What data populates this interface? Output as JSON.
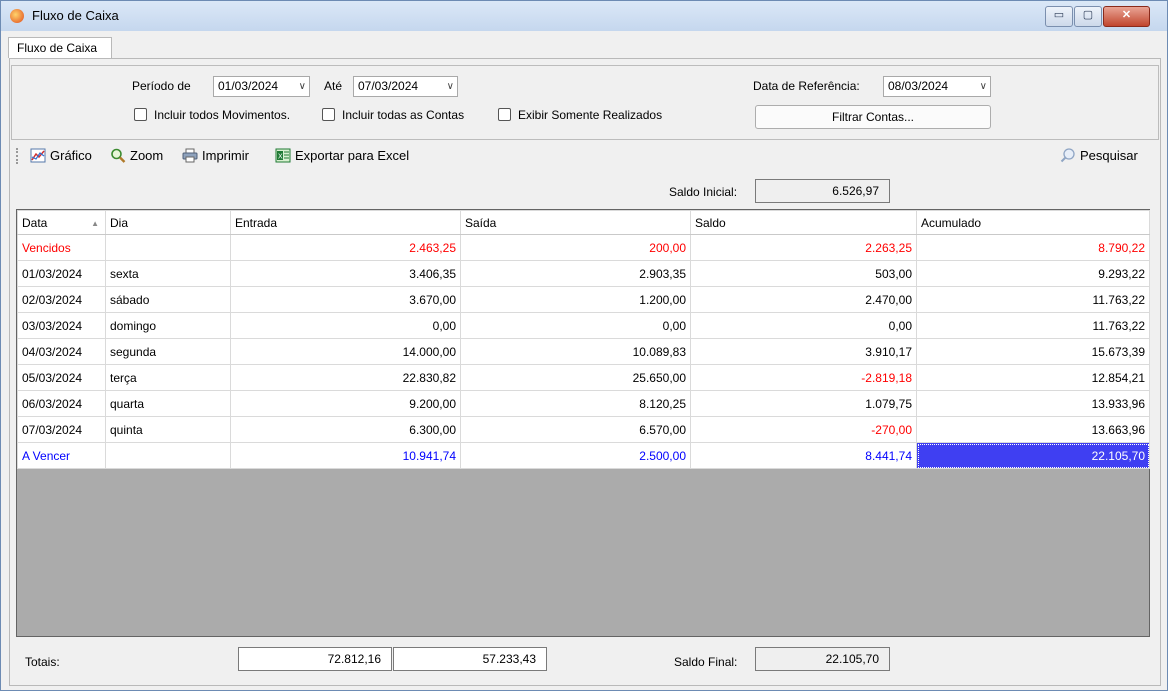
{
  "window": {
    "title": "Fluxo de Caixa",
    "controls": {
      "minimize": "▭",
      "maximize": "▢",
      "close": "✕"
    }
  },
  "tab": {
    "label": "Fluxo de Caixa"
  },
  "filters": {
    "periodo_label": "Período de",
    "periodo_de": "01/03/2024",
    "ate_label": "Até",
    "periodo_ate": "07/03/2024",
    "data_ref_label": "Data de Referência:",
    "data_ref": "08/03/2024",
    "chk_movimentos": "Incluir todos Movimentos.",
    "chk_contas": "Incluir todas as Contas",
    "chk_realizados": "Exibir Somente Realizados",
    "filtrar_button": "Filtrar Contas...",
    "dropdown_glyph": "∨"
  },
  "toolbar": {
    "grafico": "Gráfico",
    "zoom": "Zoom",
    "imprimir": "Imprimir",
    "exportar": "Exportar para Excel",
    "pesquisar": "Pesquisar"
  },
  "saldo_inicial": {
    "label": "Saldo Inicial:",
    "value": "6.526,97"
  },
  "table": {
    "headers": {
      "data": "Data",
      "dia": "Dia",
      "entrada": "Entrada",
      "saida": "Saída",
      "saldo": "Saldo",
      "acumulado": "Acumulado"
    },
    "sort_glyph": "▲",
    "rows": [
      {
        "data": "Vencidos",
        "dia": "",
        "entrada": "2.463,25",
        "saida": "200,00",
        "saldo": "2.263,25",
        "acumulado": "8.790,22"
      },
      {
        "data": "01/03/2024",
        "dia": "sexta",
        "entrada": "3.406,35",
        "saida": "2.903,35",
        "saldo": "503,00",
        "acumulado": "9.293,22"
      },
      {
        "data": "02/03/2024",
        "dia": "sábado",
        "entrada": "3.670,00",
        "saida": "1.200,00",
        "saldo": "2.470,00",
        "acumulado": "11.763,22"
      },
      {
        "data": "03/03/2024",
        "dia": "domingo",
        "entrada": "0,00",
        "saida": "0,00",
        "saldo": "0,00",
        "acumulado": "11.763,22"
      },
      {
        "data": "04/03/2024",
        "dia": "segunda",
        "entrada": "14.000,00",
        "saida": "10.089,83",
        "saldo": "3.910,17",
        "acumulado": "15.673,39"
      },
      {
        "data": "05/03/2024",
        "dia": "terça",
        "entrada": "22.830,82",
        "saida": "25.650,00",
        "saldo": "-2.819,18",
        "acumulado": "12.854,21"
      },
      {
        "data": "06/03/2024",
        "dia": "quarta",
        "entrada": "9.200,00",
        "saida": "8.120,25",
        "saldo": "1.079,75",
        "acumulado": "13.933,96"
      },
      {
        "data": "07/03/2024",
        "dia": "quinta",
        "entrada": "6.300,00",
        "saida": "6.570,00",
        "saldo": "-270,00",
        "acumulado": "13.663,96"
      },
      {
        "data": "A Vencer",
        "dia": "",
        "entrada": "10.941,74",
        "saida": "2.500,00",
        "saldo": "8.441,74",
        "acumulado": "22.105,70"
      }
    ]
  },
  "totais": {
    "label": "Totais:",
    "entrada": "72.812,16",
    "saida": "57.233,43"
  },
  "saldo_final": {
    "label": "Saldo Final:",
    "value": "22.105,70"
  },
  "colors": {
    "negative": "#ff0000",
    "future": "#0000ff",
    "selection": "#3f3ff2",
    "empty_grid": "#ababab"
  }
}
